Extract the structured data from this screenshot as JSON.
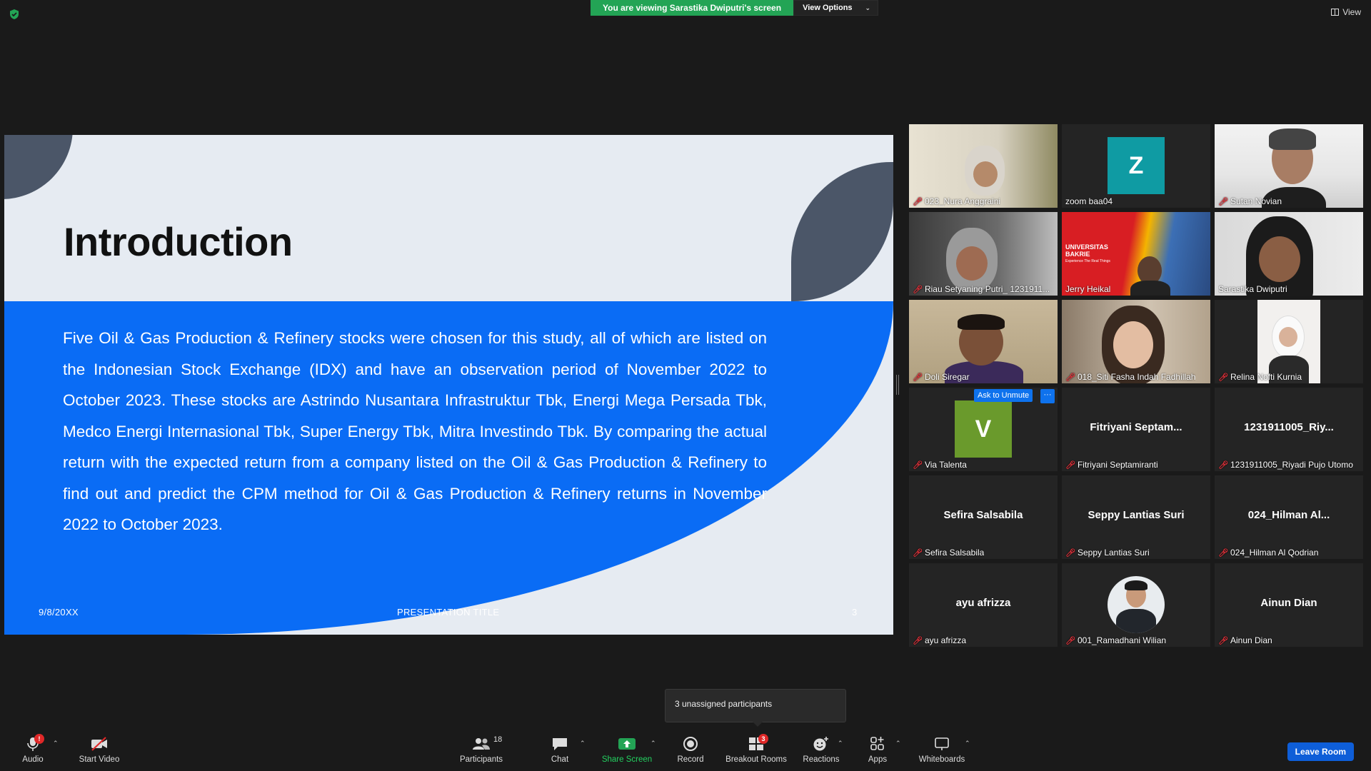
{
  "top": {
    "banner_text": "You are viewing Sarastika Dwiputri's screen",
    "view_options_label": "View Options",
    "view_label": "View"
  },
  "slide": {
    "title": "Introduction",
    "body": "Five Oil & Gas Production & Refinery stocks were chosen for this study, all of which are listed on the Indonesian Stock Exchange (IDX) and have an observation period of November 2022 to October 2023. These stocks are Astrindo Nusantara Infrastruktur Tbk, Energi Mega Persada Tbk, Medco Energi Internasional Tbk, Super Energy Tbk, Mitra Investindo Tbk. By comparing the actual return with the expected return from a company listed on the Oil & Gas Production & Refinery to find out and predict the CPM method for Oil & Gas Production & Refinery returns in November 2022 to October 2023.",
    "footer_date": "9/8/20XX",
    "footer_title": "PRESENTATION TITLE",
    "footer_page": "3"
  },
  "participants": [
    {
      "name": "023_Nura Anggraini",
      "type": "video"
    },
    {
      "name": "zoom baa04",
      "type": "avatar",
      "initial": "Z",
      "color": "#0f9ba3"
    },
    {
      "name": "Sutan Novian",
      "type": "video"
    },
    {
      "name": "Riau Setyaning Putri_ 1231911...",
      "type": "video"
    },
    {
      "name": "Jerry Heikal",
      "type": "video",
      "bg_text_1": "UNIVERSITAS",
      "bg_text_2": "BAKRIE",
      "bg_text_3": "Experience The Real Things"
    },
    {
      "name": "Sarastika Dwiputri",
      "type": "video",
      "active": true
    },
    {
      "name": "Doli Siregar",
      "type": "video"
    },
    {
      "name": "018_Siti Fasha Indah Fadhillah",
      "type": "video"
    },
    {
      "name": "Relina Nofti Kurnia",
      "type": "photo"
    },
    {
      "name": "Via Talenta",
      "type": "avatar",
      "initial": "V",
      "color": "#6a9a2c"
    },
    {
      "name": "Fitriyani Septamiranti",
      "type": "text",
      "display": "Fitriyani  Septam..."
    },
    {
      "name": "1231911005_Riyadi Pujo Utomo",
      "type": "text",
      "display": "1231911005_Riy..."
    },
    {
      "name": "Sefira Salsabila",
      "type": "text",
      "display": "Sefira Salsabila"
    },
    {
      "name": "Seppy Lantias Suri",
      "type": "text",
      "display": "Seppy Lantias Suri"
    },
    {
      "name": "024_Hilman Al Qodrian",
      "type": "text",
      "display": "024_Hilman  Al..."
    },
    {
      "name": "ayu afrizza",
      "type": "text",
      "display": "ayu afrizza"
    },
    {
      "name": "001_Ramadhani Wilian",
      "type": "photo-round"
    },
    {
      "name": "Ainun Dian",
      "type": "text",
      "display": "Ainun Dian"
    }
  ],
  "ask_to_unmute": "Ask to Unmute",
  "more_label": "···",
  "popup_text": "3 unassigned participants",
  "toolbar": {
    "audio": "Audio",
    "audio_badge": "!",
    "start_video": "Start Video",
    "participants": "Participants",
    "participants_count": "18",
    "chat": "Chat",
    "share_screen": "Share Screen",
    "record": "Record",
    "breakout_rooms": "Breakout Rooms",
    "breakout_badge": "3",
    "reactions": "Reactions",
    "apps": "Apps",
    "whiteboards": "Whiteboards",
    "leave": "Leave Room"
  },
  "colors": {
    "accent_green": "#23a455",
    "slide_blue": "#0a6cf5",
    "leave_blue": "#0e5ed8",
    "mute_red": "#e2313a",
    "active_speaker": "#e7e38a"
  }
}
